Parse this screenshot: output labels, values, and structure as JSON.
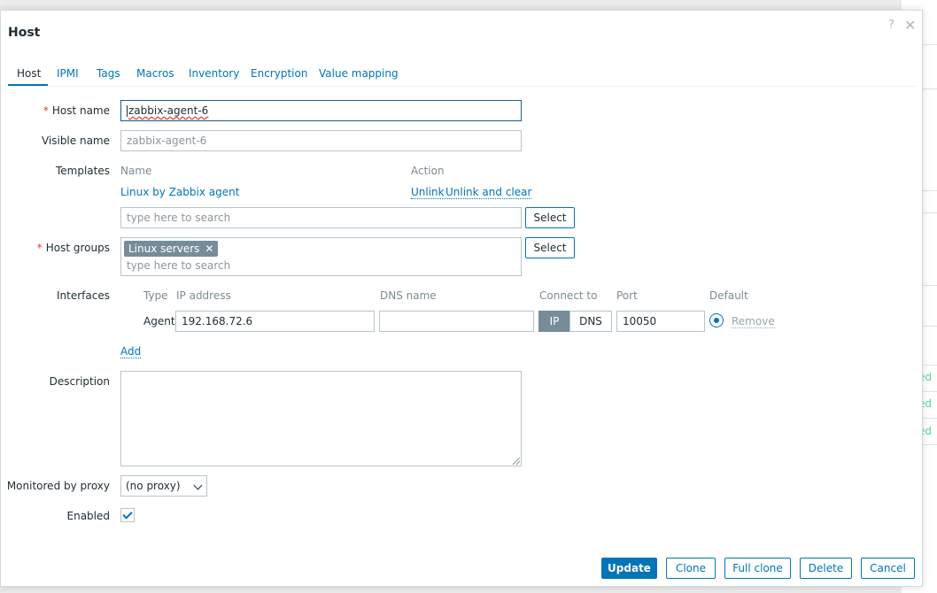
{
  "background": {
    "status_items": [
      "ed",
      "ed",
      "ed"
    ],
    "accent": "#59db8f"
  },
  "dialog": {
    "title": "Host",
    "help_icon": "?",
    "close_icon": "✕"
  },
  "tabs": [
    {
      "label": "Host",
      "active": true
    },
    {
      "label": "IPMI"
    },
    {
      "label": "Tags"
    },
    {
      "label": "Macros"
    },
    {
      "label": "Inventory"
    },
    {
      "label": "Encryption"
    },
    {
      "label": "Value mapping"
    }
  ],
  "form": {
    "host_name": {
      "label": "Host name",
      "required": "*",
      "value": "zabbix-agent-6"
    },
    "visible_name": {
      "label": "Visible name",
      "placeholder": "zabbix-agent-6"
    },
    "templates": {
      "label": "Templates",
      "col_name": "Name",
      "col_action": "Action",
      "items": [
        {
          "name": "Linux by Zabbix agent",
          "unlink": "Unlink",
          "unlink_clear": "Unlink and clear"
        }
      ],
      "search_placeholder": "type here to search",
      "select_label": "Select"
    },
    "host_groups": {
      "label": "Host groups",
      "required": "*",
      "chips": [
        "Linux servers"
      ],
      "chip_remove": "✕",
      "search_placeholder": "type here to search",
      "select_label": "Select"
    },
    "interfaces": {
      "label": "Interfaces",
      "col_type": "Type",
      "col_ip": "IP address",
      "col_dns": "DNS name",
      "col_connect": "Connect to",
      "col_port": "Port",
      "col_default": "Default",
      "rows": [
        {
          "type": "Agent",
          "ip": "192.168.72.6",
          "dns": "",
          "connect_ip": "IP",
          "connect_dns": "DNS",
          "connect_selected": "IP",
          "port": "10050",
          "remove": "Remove"
        }
      ],
      "add_label": "Add"
    },
    "description": {
      "label": "Description",
      "value": ""
    },
    "proxy": {
      "label": "Monitored by proxy",
      "value": "(no proxy)"
    },
    "enabled": {
      "label": "Enabled",
      "checked": true
    }
  },
  "footer": {
    "update": "Update",
    "clone": "Clone",
    "full_clone": "Full clone",
    "delete": "Delete",
    "cancel": "Cancel"
  }
}
